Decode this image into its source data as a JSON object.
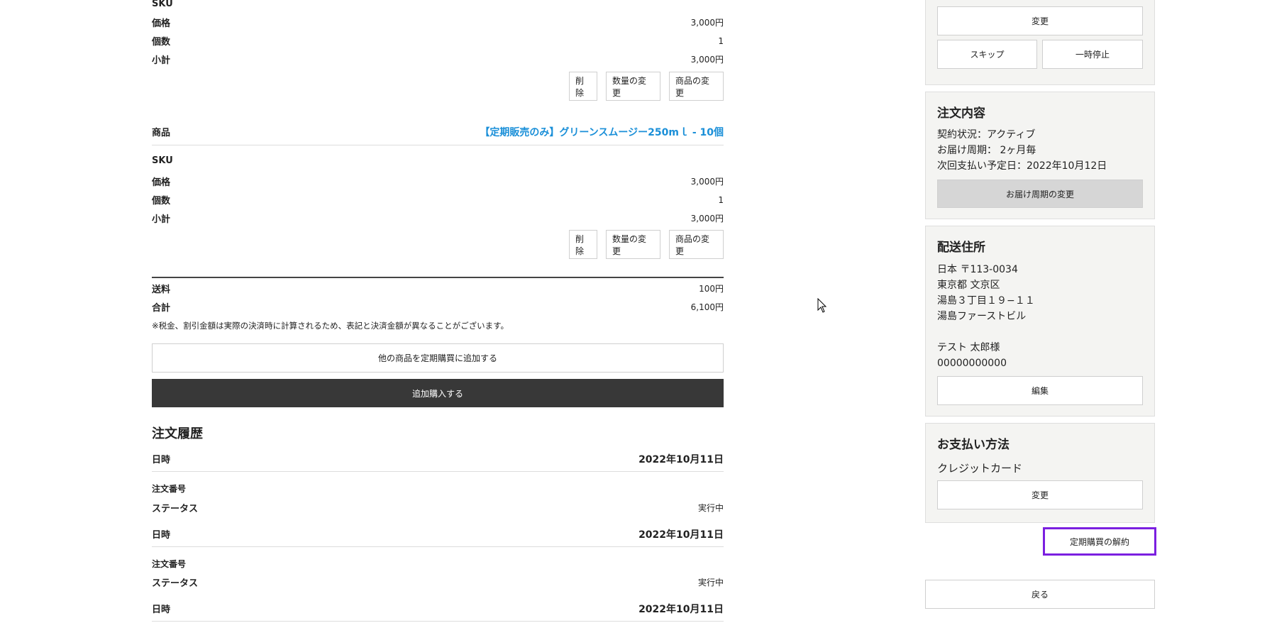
{
  "product1": {
    "sku_label": "SKU",
    "rows": [
      {
        "label": "価格",
        "value": "3,000円"
      },
      {
        "label": "個数",
        "value": "1"
      },
      {
        "label": "小計",
        "value": "3,000円"
      }
    ],
    "buttons": {
      "delete": "削除",
      "change_qty": "数量の変更",
      "change_product": "商品の変更"
    }
  },
  "product2": {
    "product_label": "商品",
    "product_name": "【定期販売のみ】グリーンスムージー250mｌ - 10個",
    "sku_label": "SKU",
    "rows": [
      {
        "label": "価格",
        "value": "3,000円"
      },
      {
        "label": "個数",
        "value": "1"
      },
      {
        "label": "小計",
        "value": "3,000円"
      }
    ],
    "buttons": {
      "delete": "削除",
      "change_qty": "数量の変更",
      "change_product": "商品の変更"
    }
  },
  "totals": {
    "shipping_label": "送料",
    "shipping_value": "100円",
    "total_label": "合計",
    "total_value": "6,100円",
    "note": "※税金、割引金額は実際の決済時に計算されるため、表記と決済金額が異なることがございます。"
  },
  "actions": {
    "add_other": "他の商品を定期購買に追加する",
    "add_purchase": "追加購入する"
  },
  "history": {
    "title": "注文履歴",
    "entries": [
      {
        "date_label": "日時",
        "date_value": "2022年10月11日",
        "order_label": "注文番号",
        "status_label": "ステータス",
        "status_value": "実行中"
      },
      {
        "date_label": "日時",
        "date_value": "2022年10月11日",
        "order_label": "注文番号",
        "status_label": "ステータス",
        "status_value": "実行中"
      },
      {
        "date_label": "日時",
        "date_value": "2022年10月11日"
      }
    ]
  },
  "sidebar": {
    "top": {
      "change": "変更",
      "skip": "スキップ",
      "pause": "一時停止"
    },
    "order": {
      "title": "注文内容",
      "status": "契約状況：アクティブ",
      "cycle": "お届け周期： 2ヶ月毎",
      "next_payment": "次回支払い予定日：2022年10月12日",
      "change_cycle": "お届け周期の変更"
    },
    "address": {
      "title": "配送住所",
      "line1": "日本 〒113-0034",
      "line2": "東京都 文京区",
      "line3": "湯島３丁目１９−１１",
      "line4": "湯島ファーストビル",
      "name": "テスト 太郎様",
      "phone": "00000000000",
      "edit": "編集"
    },
    "payment": {
      "title": "お支払い方法",
      "method": "クレジットカード",
      "change": "変更"
    },
    "cancel": "定期購買の解約",
    "back": "戻る"
  },
  "colors": {
    "link": "#1a8fd8",
    "dark_button": "#383838",
    "cancel_border": "#7b1fe0"
  }
}
